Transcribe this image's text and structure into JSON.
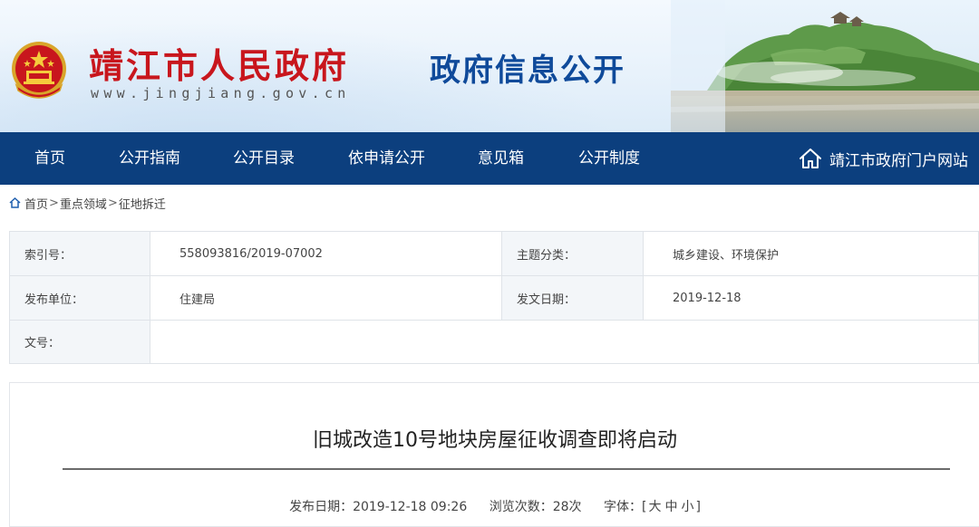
{
  "header": {
    "site_name": "靖江市人民政府",
    "site_url": "www.jingjiang.gov.cn",
    "portal_title": "政府信息公开",
    "emblem_icon": "national-emblem-icon",
    "colors": {
      "site_name": "#c8161d",
      "portal_title": "#0f4a9a",
      "nav_bg": "#0c3f7e"
    }
  },
  "nav": {
    "items": [
      {
        "label": "首页"
      },
      {
        "label": "公开指南"
      },
      {
        "label": "公开目录"
      },
      {
        "label": "依申请公开"
      },
      {
        "label": "意见箱"
      },
      {
        "label": "公开制度"
      }
    ],
    "portal_link": {
      "label": "靖江市政府门户网站",
      "icon": "home-icon"
    }
  },
  "breadcrumb": {
    "icon": "home-icon",
    "items": [
      "首页",
      "重点领域",
      "征地拆迁"
    ],
    "separator": ">"
  },
  "meta": {
    "index_label": "索引号：",
    "index_value": "558093816/2019-07002",
    "topic_label": "主题分类：",
    "topic_value": "城乡建设、环境保护",
    "publisher_label": "发布单位：",
    "publisher_value": "住建局",
    "issue_date_label": "发文日期：",
    "issue_date_value": "2019-12-18",
    "doc_no_label": "文号：",
    "doc_no_value": ""
  },
  "article": {
    "title": "旧城改造10号地块房屋征收调查即将启动",
    "publish_label": "发布日期：",
    "publish_value": "2019-12-18 09:26",
    "views_label": "浏览次数：",
    "views_value": "28次",
    "font_label": "字体：",
    "font_open": "[",
    "font_large": "大",
    "font_medium": "中",
    "font_small": "小",
    "font_close": "]"
  }
}
